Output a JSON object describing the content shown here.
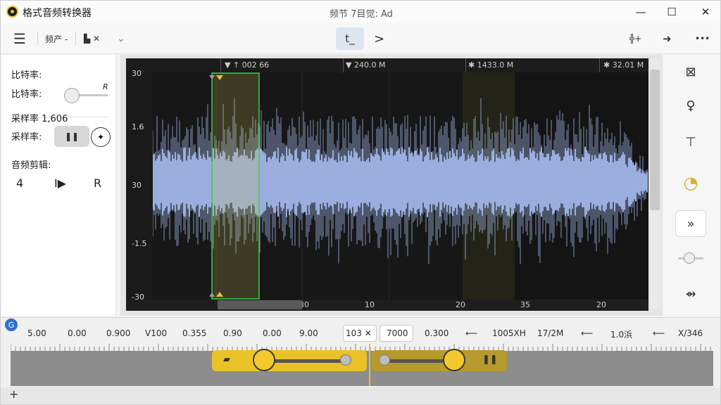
{
  "titlebar": {
    "app_title": "格式音频转换器",
    "doc_title": "频节 7目觉: Ad",
    "minimize": "—",
    "maximize": "☐",
    "close": "✕"
  },
  "toolbar": {
    "menu": "☰",
    "item1": "频产 -",
    "item2": "▙̶ ✕",
    "item2_caret": "⌄",
    "active_tool": "t_",
    "next": ">",
    "right1": "╬+",
    "right2": "➜",
    "more": "•••"
  },
  "left_panel": {
    "bitrate_heading": "比特率:",
    "bitrate_label": "比特率:",
    "bitrate_letter": "R",
    "bitrate_level": 0.1,
    "samplerate_heading": "采样率 1,606",
    "samplerate_label": "采样率:",
    "pause_glyph": "❚❚",
    "circle_glyph": "✦",
    "edit_heading": "音频剪辑:",
    "ctrl1": "4",
    "ctrl2": "I▶",
    "ctrl3": "R"
  },
  "ruler_top": [
    "▼ ↑ 002 66",
    "▼ 240.0 M",
    "✱ 1433.0 M",
    "✱ 32.01 M"
  ],
  "y_axis": [
    "30",
    "1.6",
    "30",
    "-1.5",
    "-30"
  ],
  "ruler_bottom": [
    "30",
    "10",
    "20",
    "35",
    "20"
  ],
  "right_tools": [
    "⊠",
    "♀",
    "⊤",
    "◔",
    "»",
    "⇴"
  ],
  "timeline": {
    "badge": "G",
    "labels": [
      "5.00",
      "0.00",
      "0.900",
      "V100",
      "0.355",
      "0.90",
      "0.00",
      "9.00",
      "103 ✕",
      "7000",
      "0.300",
      "⟵",
      "1005XH",
      "17/2M",
      "⟵",
      "1.0浜",
      "⟵",
      "X/346"
    ],
    "add": "+",
    "left_seg_glyph": "▰",
    "right_seg_glyph": "❚❚"
  },
  "colors": {
    "wave": "#9fb4e6",
    "selection": "#35d14a",
    "accent": "#e9c227"
  }
}
